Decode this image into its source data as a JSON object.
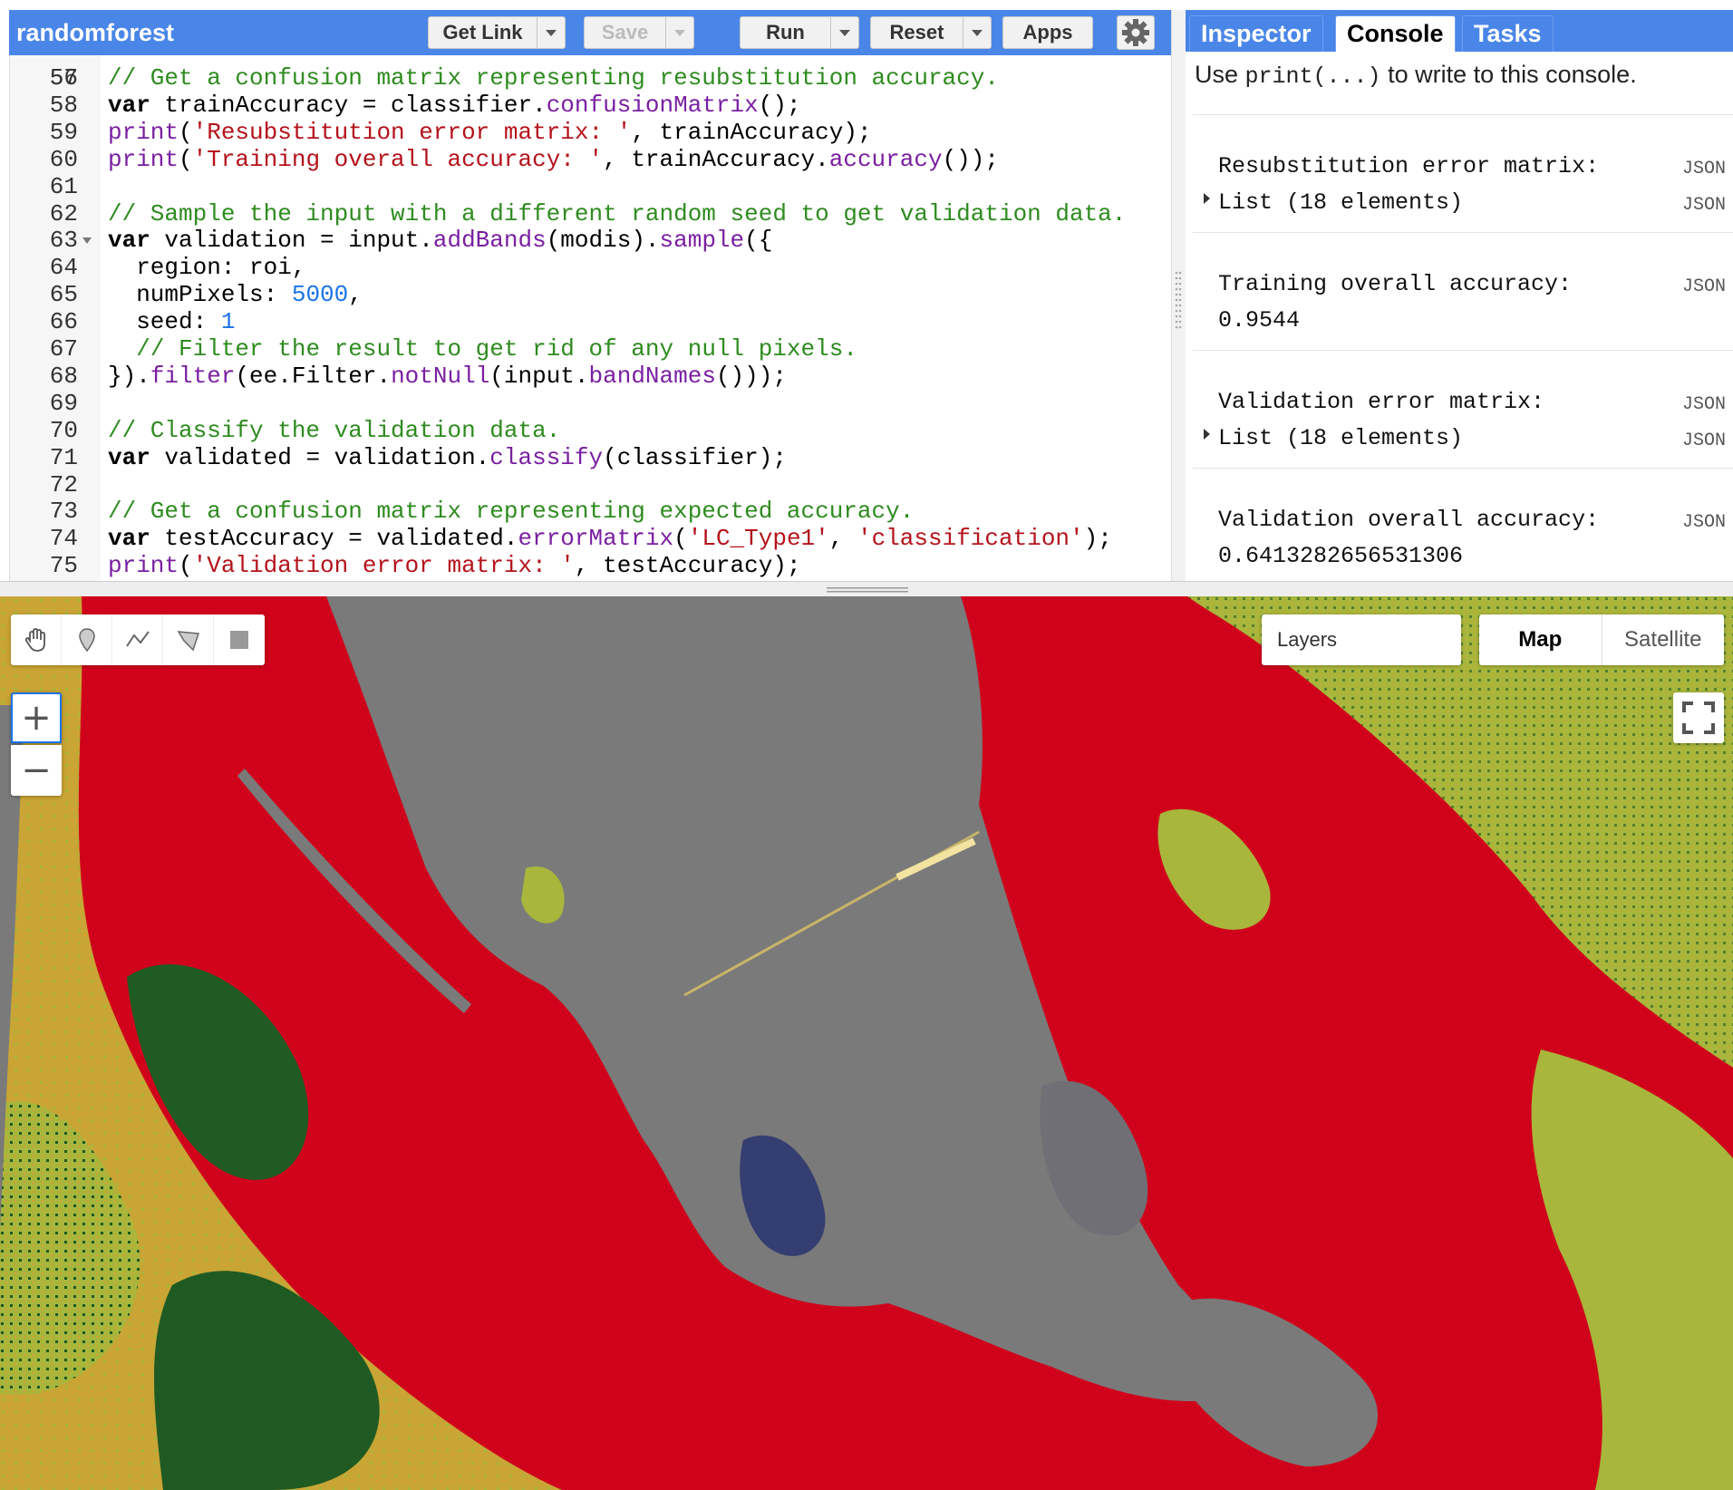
{
  "header": {
    "title": "randomforest",
    "buttons": {
      "get_link": "Get Link",
      "save": "Save",
      "run": "Run",
      "reset": "Reset",
      "apps": "Apps"
    }
  },
  "code": {
    "partial_top_line": "56",
    "lines": [
      {
        "n": "57",
        "t": "// Get a confusion matrix representing resubstitution accuracy."
      },
      {
        "n": "58",
        "t": "var trainAccuracy = classifier.confusionMatrix();"
      },
      {
        "n": "59",
        "t": "print('Resubstitution error matrix: ', trainAccuracy);"
      },
      {
        "n": "60",
        "t": "print('Training overall accuracy: ', trainAccuracy.accuracy());"
      },
      {
        "n": "61",
        "t": ""
      },
      {
        "n": "62",
        "t": "// Sample the input with a different random seed to get validation data."
      },
      {
        "n": "63",
        "t": "var validation = input.addBands(modis).sample({"
      },
      {
        "n": "64",
        "t": "  region: roi,"
      },
      {
        "n": "65",
        "t": "  numPixels: 5000,"
      },
      {
        "n": "66",
        "t": "  seed: 1"
      },
      {
        "n": "67",
        "t": "  // Filter the result to get rid of any null pixels."
      },
      {
        "n": "68",
        "t": "}).filter(ee.Filter.notNull(input.bandNames()));"
      },
      {
        "n": "69",
        "t": ""
      },
      {
        "n": "70",
        "t": "// Classify the validation data."
      },
      {
        "n": "71",
        "t": "var validated = validation.classify(classifier);"
      },
      {
        "n": "72",
        "t": ""
      },
      {
        "n": "73",
        "t": "// Get a confusion matrix representing expected accuracy."
      },
      {
        "n": "74",
        "t": "var testAccuracy = validated.errorMatrix('LC_Type1', 'classification');"
      },
      {
        "n": "75",
        "t": "print('Validation error matrix: ', testAccuracy);"
      }
    ]
  },
  "panel": {
    "tabs": [
      "Inspector",
      "Console",
      "Tasks"
    ],
    "active_tab": "Console",
    "hint_before": "Use ",
    "hint_code": "print(...)",
    "hint_after": " to write to this console.",
    "entries": [
      {
        "label": "Resubstitution error matrix:",
        "value": "List (18 elements)",
        "expandable": true,
        "json1": "JSON",
        "json2": "JSON"
      },
      {
        "label": "Training overall accuracy:",
        "value": "0.9544",
        "expandable": false,
        "json1": "JSON"
      },
      {
        "label": "Validation error matrix:",
        "value": "List (18 elements)",
        "expandable": true,
        "json1": "JSON",
        "json2": "JSON"
      },
      {
        "label": "Validation overall accuracy:",
        "value": "0.6413282656531306",
        "expandable": false,
        "json1": "JSON"
      }
    ]
  },
  "map": {
    "layers_label": "Layers",
    "map_type_options": [
      "Map",
      "Satellite"
    ],
    "selected_map_type": "Map",
    "zoom_in": "+",
    "zoom_out": "−",
    "tools": [
      "hand-icon",
      "marker-icon",
      "line-icon",
      "polygon-icon",
      "rectangle-icon"
    ],
    "colors": {
      "urban": "#d0021b",
      "water": "#7a7a7a",
      "grass": "#a8b63c",
      "shrub": "#d9a032",
      "forest": "#1f5a23",
      "wetland": "#1c2a6b"
    }
  },
  "colors": {
    "header_blue": "#4a86e8",
    "comment": "#2e8b1f",
    "string": "#b5121b",
    "function": "#7a1fa2",
    "number": "#1a73e8"
  }
}
